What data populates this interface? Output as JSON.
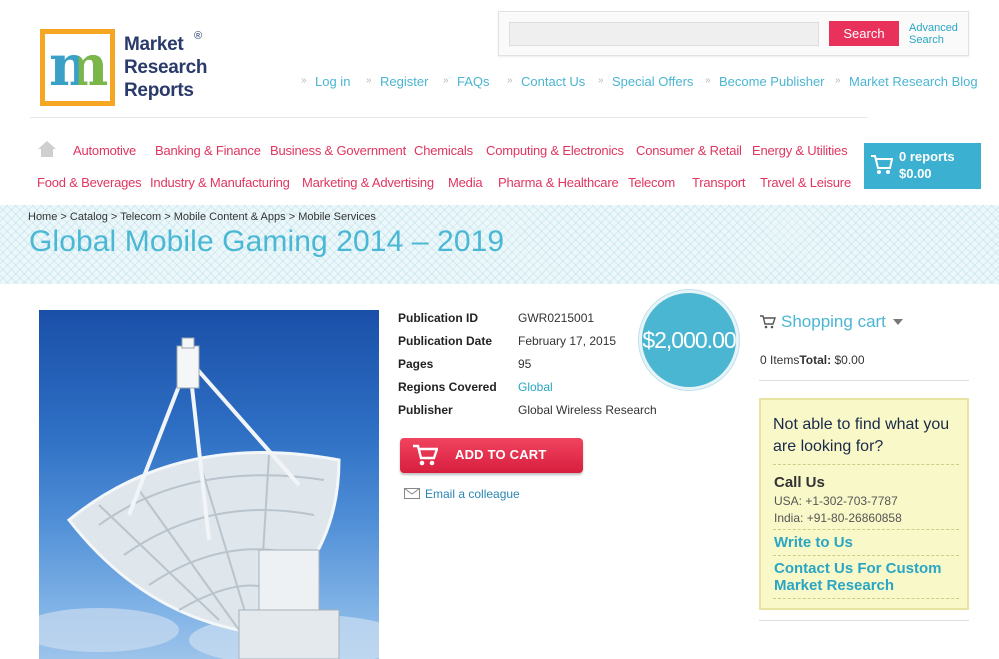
{
  "logo": {
    "text_lines": [
      "Market",
      "Research",
      "Reports"
    ],
    "registered": "®",
    "mark_letter": "m"
  },
  "search": {
    "value": "",
    "placeholder": "",
    "button_label": "Search",
    "advanced_line1": "Advanced",
    "advanced_line2": "Search"
  },
  "top_links": [
    "Log in",
    "Register",
    "FAQs",
    "Contact Us",
    "Special Offers",
    "Become Publisher",
    "Market Research Blog"
  ],
  "categories_row1": [
    "Automotive",
    "Banking & Finance",
    "Business & Government",
    "Chemicals",
    "Computing & Electronics",
    "Consumer & Retail",
    "Energy & Utilities"
  ],
  "categories_row2": [
    "Food & Beverages",
    "Industry & Manufacturing",
    "Marketing & Advertising",
    "Media",
    "Pharma & Healthcare",
    "Telecom",
    "Transport",
    "Travel & Leisure"
  ],
  "cart": {
    "count": "0 reports",
    "total": "$0.00"
  },
  "breadcrumb": [
    "Home",
    "Catalog",
    "Telecom",
    "Mobile Content & Apps",
    "Mobile Services"
  ],
  "breadcrumb_sep": ">",
  "page_title": "Global Mobile Gaming 2014 – 2019",
  "details": [
    {
      "label": "Publication ID",
      "value": "GWR0215001"
    },
    {
      "label": "Publication Date",
      "value": "February 17, 2015"
    },
    {
      "label": "Pages",
      "value": "95"
    },
    {
      "label": "Regions Covered",
      "value": "Global"
    },
    {
      "label": "Publisher",
      "value": "Global Wireless Research"
    }
  ],
  "price": "$2,000.00",
  "add_to_cart_label": "ADD TO CART",
  "email_label": "Email a colleague",
  "shopping_cart": {
    "title": "Shopping cart",
    "items": "0 Items",
    "total_label": "Total:",
    "total_value": "$0.00"
  },
  "help": {
    "question": "Not able to find what you are looking for?",
    "call_us": "Call Us",
    "phone_usa": "USA: +1-302-703-7787",
    "phone_india": "India: +91-80-26860858",
    "write_to_us": "Write to Us",
    "custom_research": "Contact Us For Custom Market Research"
  },
  "colors": {
    "accent_blue": "#4ab6d2",
    "accent_pink": "#e0355f",
    "cart_blue": "#3cb0d0",
    "add_cart_red": "#d81e3e",
    "help_bg": "#f9f8c8"
  },
  "icons": [
    "home-icon",
    "cart-icon",
    "email-icon",
    "shopping-cart-icon",
    "chevron-down-icon"
  ]
}
